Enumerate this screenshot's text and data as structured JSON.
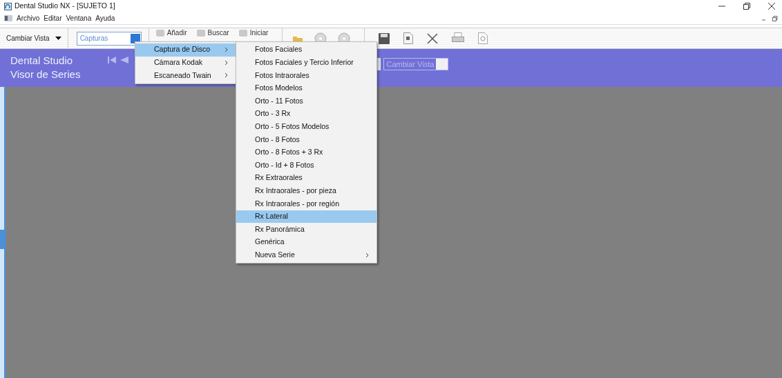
{
  "window": {
    "title": "Dental Studio NX - [SUJETO 1]"
  },
  "menu_bar": [
    "Archivo",
    "Editar",
    "Ventana",
    "Ayuda"
  ],
  "toolbar": {
    "view_dropdown": "Cambiar Vista",
    "capture_field": "Capturas",
    "buttons": [
      "Añadir",
      "Buscar",
      "Iniciar"
    ]
  },
  "header": {
    "title": "Dental Studio",
    "subtitle": "Visor de Series",
    "view_dropdown": "Cambiar Vista"
  },
  "capture_menu": [
    {
      "label": "Captura de Disco",
      "selected": true,
      "submenu": true
    },
    {
      "label": "Cámara Kodak",
      "selected": false,
      "submenu": true
    },
    {
      "label": "Escaneado Twain",
      "selected": false,
      "submenu": true
    }
  ],
  "series_menu": [
    {
      "label": "Fotos Faciales",
      "selected": false,
      "submenu": false
    },
    {
      "label": "Fotos Faciales y Tercio Inferior",
      "selected": false,
      "submenu": false
    },
    {
      "label": "Fotos Intraorales",
      "selected": false,
      "submenu": false
    },
    {
      "label": "Fotos Modelos",
      "selected": false,
      "submenu": false
    },
    {
      "label": "Orto - 11 Fotos",
      "selected": false,
      "submenu": false
    },
    {
      "label": "Orto - 3 Rx",
      "selected": false,
      "submenu": false
    },
    {
      "label": "Orto - 5 Fotos Modelos",
      "selected": false,
      "submenu": false
    },
    {
      "label": "Orto - 8 Fotos",
      "selected": false,
      "submenu": false
    },
    {
      "label": "Orto - 8 Fotos + 3 Rx",
      "selected": false,
      "submenu": false
    },
    {
      "label": "Orto - Id + 8 Fotos",
      "selected": false,
      "submenu": false
    },
    {
      "label": "Rx Extraorales",
      "selected": false,
      "submenu": false
    },
    {
      "label": "Rx Intraorales - por pieza",
      "selected": false,
      "submenu": false
    },
    {
      "label": "Rx Intraorales - por región",
      "selected": false,
      "submenu": false
    },
    {
      "label": "Rx Lateral",
      "selected": true,
      "submenu": false
    },
    {
      "label": "Rx Panorámica",
      "selected": false,
      "submenu": false
    },
    {
      "label": "Genérica",
      "selected": false,
      "submenu": false
    },
    {
      "label": "Nueva Serie",
      "selected": false,
      "submenu": true
    }
  ]
}
